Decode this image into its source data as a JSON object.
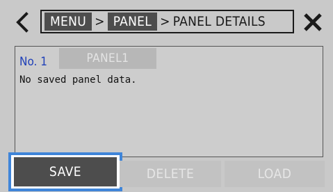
{
  "topbar": {
    "back_icon": "chevron-left-icon",
    "close_icon": "close-x-icon",
    "breadcrumb": {
      "menu": "MENU",
      "sep1": ">",
      "panel": "PANEL",
      "sep2": ">",
      "current": "PANEL DETAILS"
    }
  },
  "panel": {
    "number": "No. 1",
    "name": "PANEL1",
    "message": "No saved panel data."
  },
  "buttons": {
    "save": "SAVE",
    "delete": "DELETE",
    "load": "LOAD"
  },
  "colors": {
    "background": "#c9c9c9",
    "active_button": "#4d4d4d",
    "disabled_button": "#c2c2c2",
    "focus_ring": "#3f85d9",
    "panel_number": "#1e3fb8"
  }
}
